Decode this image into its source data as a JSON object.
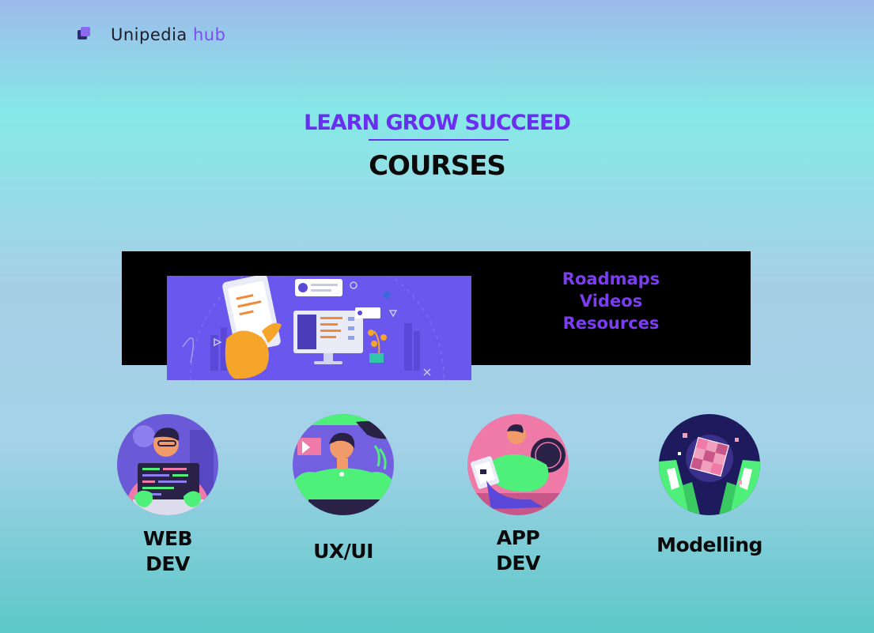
{
  "brand": {
    "name": "Unipedia",
    "suffix": "hub"
  },
  "hero": {
    "tagline": "LEARN GROW SUCCEED",
    "title": "COURSES"
  },
  "banner": {
    "image_icon": "developer-illustration",
    "links": [
      "Roadmaps",
      "Videos",
      "Resources"
    ]
  },
  "courses": [
    {
      "label": "WEB DEV",
      "icon": "web-developer-illustration"
    },
    {
      "label": "UX/UI",
      "icon": "ux-designer-illustration"
    },
    {
      "label": "APP DEV",
      "icon": "app-developer-illustration"
    },
    {
      "label": "Modelling",
      "icon": "cube-model-illustration"
    }
  ],
  "colors": {
    "accent": "#6a2ef0",
    "link": "#7b3cf3",
    "banner_bg": "#000000",
    "text_dark": "#0a0a0a"
  }
}
